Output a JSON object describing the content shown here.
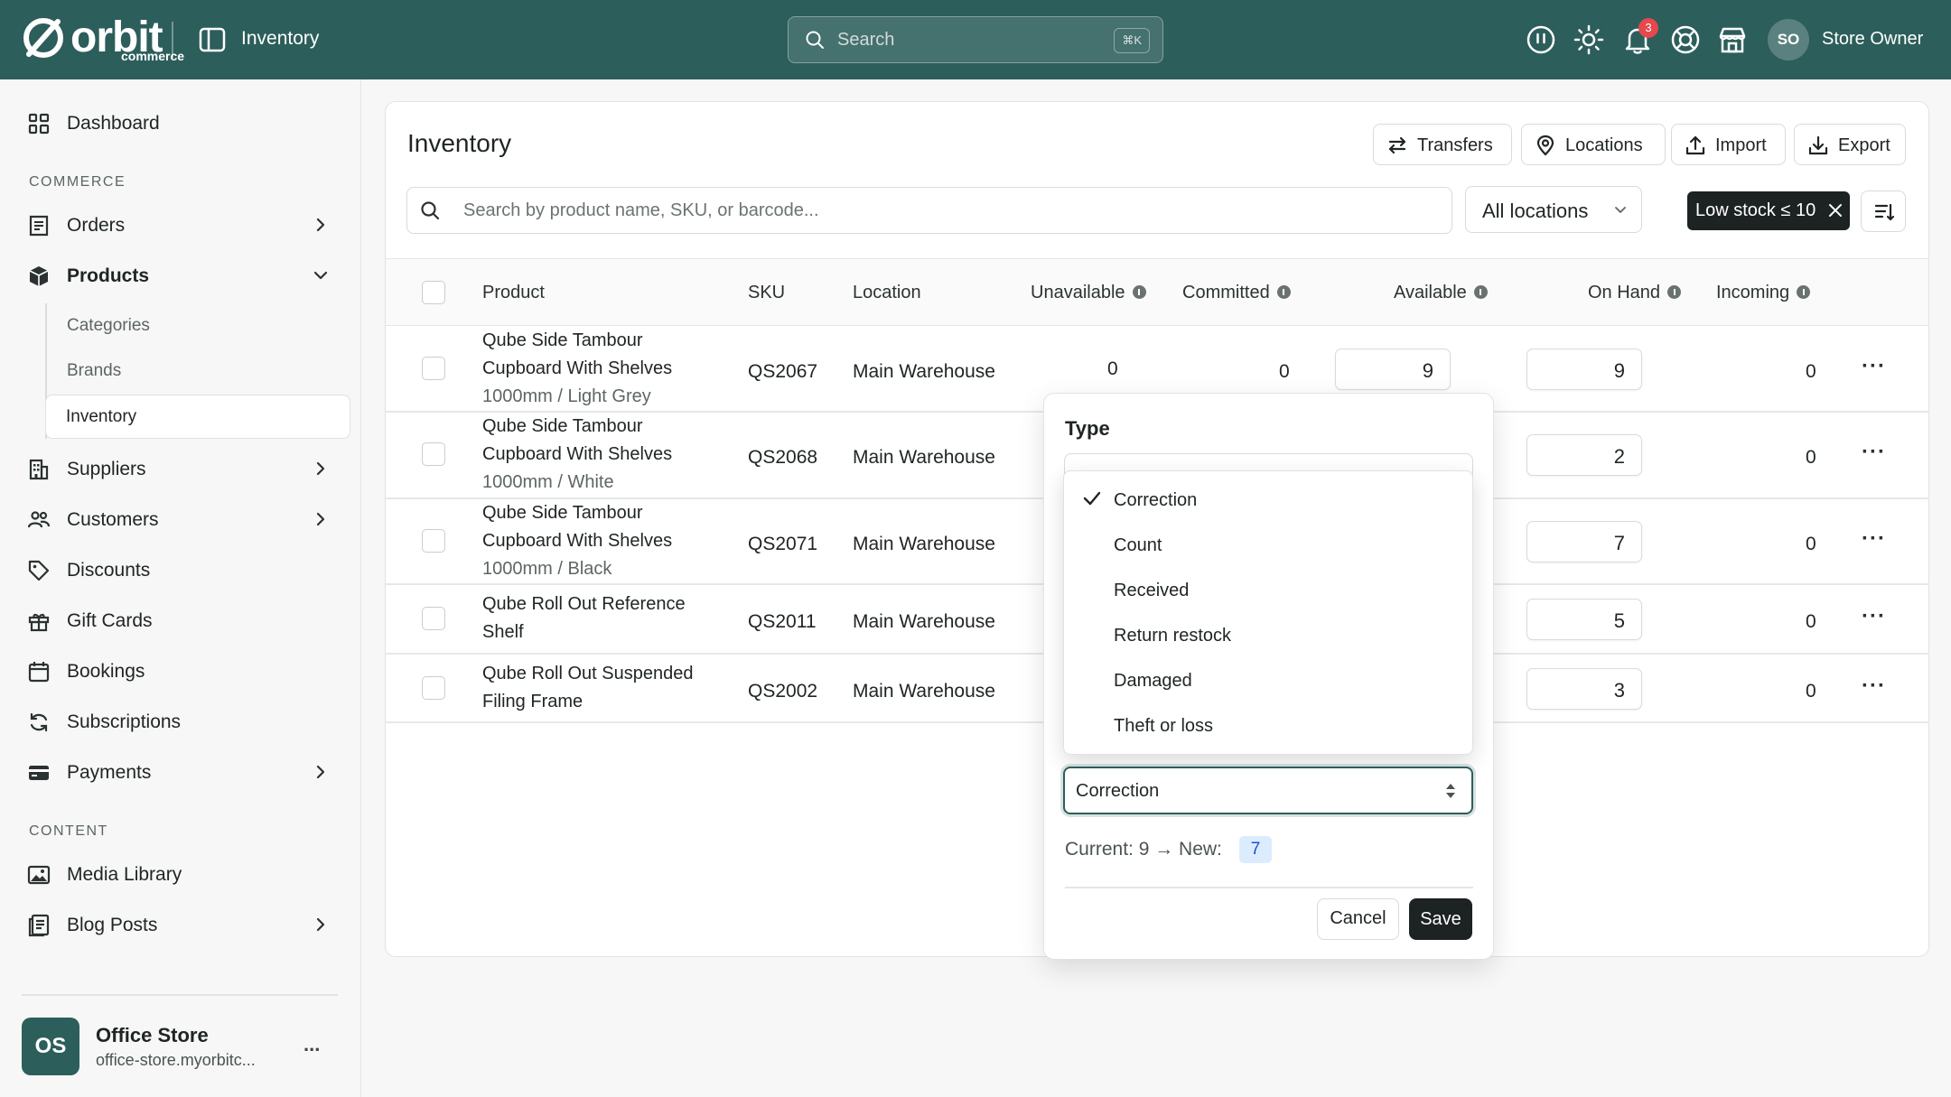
{
  "colors": {
    "topbar": "#2c5e5b",
    "accent": "#2c5e5b",
    "danger": "#e5484d",
    "dark_button": "#1d2222"
  },
  "topbar": {
    "brand": "orbit",
    "brand_sub": "commerce",
    "section": "Inventory",
    "search_placeholder": "Search",
    "search_shortcut": "⌘K",
    "notifications_count": "3",
    "user_initials": "SO",
    "user_name": "Store Owner",
    "icons": [
      "pause-icon",
      "sun-icon",
      "bell-icon",
      "help-icon",
      "store-icon"
    ]
  },
  "sidebar": {
    "dashboard": "Dashboard",
    "commerce_label": "COMMERCE",
    "orders": "Orders",
    "products": "Products",
    "sub": {
      "categories": "Categories",
      "brands": "Brands",
      "inventory": "Inventory"
    },
    "suppliers": "Suppliers",
    "customers": "Customers",
    "discounts": "Discounts",
    "gift_cards": "Gift Cards",
    "bookings": "Bookings",
    "subscriptions": "Subscriptions",
    "payments": "Payments",
    "content_label": "CONTENT",
    "media_library": "Media Library",
    "blog_posts": "Blog Posts",
    "store": {
      "initials": "OS",
      "name": "Office Store",
      "url": "office-store.myorbitc...",
      "more": "..."
    }
  },
  "page": {
    "title": "Inventory",
    "actions": {
      "transfers": "Transfers",
      "locations": "Locations",
      "import": "Import",
      "export": "Export"
    },
    "search_placeholder": "Search by product name, SKU, or barcode...",
    "location_filter": "All locations",
    "active_filter": "Low stock ≤ 10"
  },
  "table": {
    "headers": {
      "product": "Product",
      "sku": "SKU",
      "location": "Location",
      "unavailable": "Unavailable",
      "committed": "Committed",
      "available": "Available",
      "on_hand": "On Hand",
      "incoming": "Incoming"
    },
    "rows": [
      {
        "line1": "Qube Side Tambour",
        "line2": "Cupboard With Shelves",
        "variant": "1000mm / Light Grey",
        "sku": "QS2067",
        "location": "Main Warehouse",
        "unavailable": "0",
        "committed": "0",
        "available": "9",
        "on_hand": "9",
        "incoming": "0"
      },
      {
        "line1": "Qube Side Tambour",
        "line2": "Cupboard With Shelves",
        "variant": "1000mm / White",
        "sku": "QS2068",
        "location": "Main Warehouse",
        "on_hand": "2",
        "incoming": "0"
      },
      {
        "line1": "Qube Side Tambour",
        "line2": "Cupboard With Shelves",
        "variant": "1000mm / Black",
        "sku": "QS2071",
        "location": "Main Warehouse",
        "on_hand": "7",
        "incoming": "0"
      },
      {
        "line1": "Qube Roll Out Reference",
        "line2": "Shelf",
        "sku": "QS2011",
        "location": "Main Warehouse",
        "on_hand": "5",
        "incoming": "0"
      },
      {
        "line1": "Qube Roll Out Suspended",
        "line2": "Filing Frame",
        "sku": "QS2002",
        "location": "Main Warehouse",
        "on_hand": "3",
        "incoming": "0"
      }
    ],
    "row_more": "···"
  },
  "popover": {
    "type_label": "Type",
    "options": [
      "Correction",
      "Count",
      "Received",
      "Return restock",
      "Damaged",
      "Theft or loss"
    ],
    "selected": "Correction",
    "current_text": "Current: 9 → New:",
    "new_value": "7",
    "cancel": "Cancel",
    "save": "Save"
  }
}
